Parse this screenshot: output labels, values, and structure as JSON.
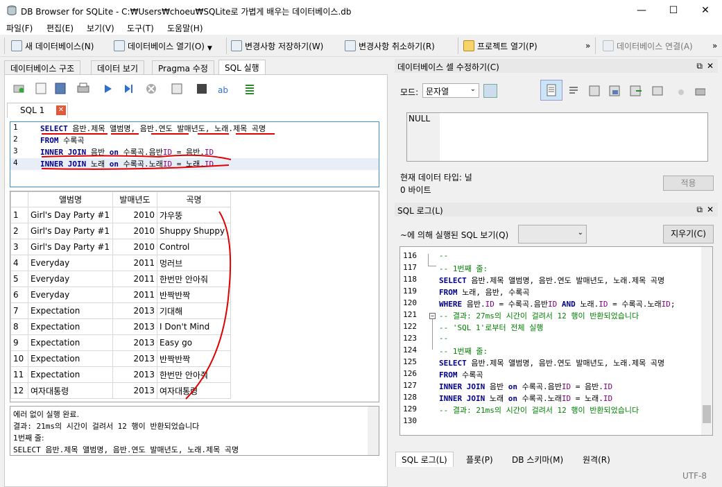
{
  "window": {
    "title": "DB Browser for SQLite - C:₩Users₩choeu₩SQLite로 가볍게 배우는 데이터베이스.db",
    "minimize": "—",
    "maximize": "☐",
    "close": "✕"
  },
  "menu": [
    "파일(F)",
    "편집(E)",
    "보기(V)",
    "도구(T)",
    "도움말(H)"
  ],
  "toolbar": {
    "new_db": "새 데이터베이스(N)",
    "open_db": "데이터베이스 열기(O)",
    "write": "변경사항 저장하기(W)",
    "revert": "변경사항 취소하기(R)",
    "open_project": "프로젝트 열기(P)",
    "attach": "데이터베이스 연결(A)",
    "overflow": "»"
  },
  "tabs": [
    "데이터베이스 구조",
    "데이터 보기",
    "Pragma 수정",
    "SQL 실행"
  ],
  "sql_tab": {
    "label": "SQL 1"
  },
  "editor": {
    "lines": [
      "1",
      "2",
      "3",
      "4"
    ]
  },
  "results": {
    "headers": [
      "",
      "앨범명",
      "발매년도",
      "곡명"
    ],
    "rows": [
      [
        "1",
        "Girl's Day Party #1",
        "2010",
        "갸우뚱"
      ],
      [
        "2",
        "Girl's Day Party #1",
        "2010",
        "Shuppy Shuppy"
      ],
      [
        "3",
        "Girl's Day Party #1",
        "2010",
        "Control"
      ],
      [
        "4",
        "Everyday",
        "2011",
        "멍러브"
      ],
      [
        "5",
        "Everyday",
        "2011",
        "한번만 안아줘"
      ],
      [
        "6",
        "Everyday",
        "2011",
        "반짝반짝"
      ],
      [
        "7",
        "Expectation",
        "2013",
        "기대해"
      ],
      [
        "8",
        "Expectation",
        "2013",
        "I Don't Mind"
      ],
      [
        "9",
        "Expectation",
        "2013",
        "Easy go"
      ],
      [
        "10",
        "Expectation",
        "2013",
        "반짝반짝"
      ],
      [
        "11",
        "Expectation",
        "2013",
        "한번만 안아줘"
      ],
      [
        "12",
        "여자대통령",
        "2013",
        "여자대통령"
      ]
    ]
  },
  "message": [
    "에러 없이 실행 완료.",
    "결과: 21ms의 시간이 걸려서 12 행이 반환되었습니다",
    "1번째 줄:",
    "SELECT 음반.제목 앨범명, 음반.연도 발매년도, 노래.제목 곡명"
  ],
  "cell_editor": {
    "title": "데이터베이스 셀 수정하기(C)",
    "mode_label": "모드:",
    "mode_value": "문자열",
    "value": "NULL",
    "type_label": "현재 데이터 타입: 널",
    "size_label": "0 바이트",
    "apply": "적용"
  },
  "sql_log": {
    "title": "SQL 로그(L)",
    "filter_label": "~에 의해 실행된 SQL 보기(Q)",
    "clear": "지우기(C)",
    "line_numbers": [
      "116",
      "117",
      "118",
      "119",
      "120",
      "121",
      "122",
      "123",
      "124",
      "125",
      "126",
      "127",
      "128",
      "129",
      "130"
    ]
  },
  "bottom_tabs": [
    "SQL 로그(L)",
    "플롯(P)",
    "DB 스키마(M)",
    "원격(R)"
  ],
  "status": {
    "encoding": "UTF-8"
  },
  "pane_buttons": {
    "float": "⧉",
    "close": "✕"
  }
}
